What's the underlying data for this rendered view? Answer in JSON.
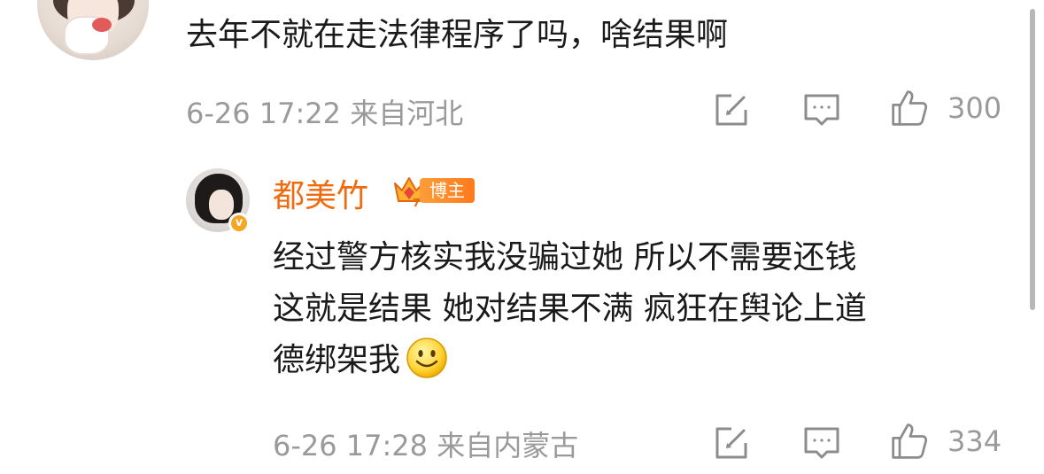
{
  "top_comment": {
    "text": "去年不就在走法律程序了吗，啥结果啊",
    "meta": "6-26 17:22 来自河北",
    "like_count": "300"
  },
  "reply": {
    "username": "都美竹",
    "badge_label": "博主",
    "lines": [
      "经过警方核实我没骗过她 所以不需要还钱",
      "这就是结果 她对结果不满 疯狂在舆论上道",
      "德绑架我"
    ],
    "emoji_icon": "smile-emoji",
    "meta": "6-26 17:28 来自内蒙古",
    "like_count": "334"
  },
  "icons": {
    "edit": "edit-icon",
    "comment": "comment-icon",
    "like": "thumbs-up-icon",
    "verified": "verified-icon"
  },
  "colors": {
    "username": "#f06a0f",
    "meta": "#9a9a9a",
    "badge": "#ff8a25",
    "verified": "#f5a623"
  }
}
